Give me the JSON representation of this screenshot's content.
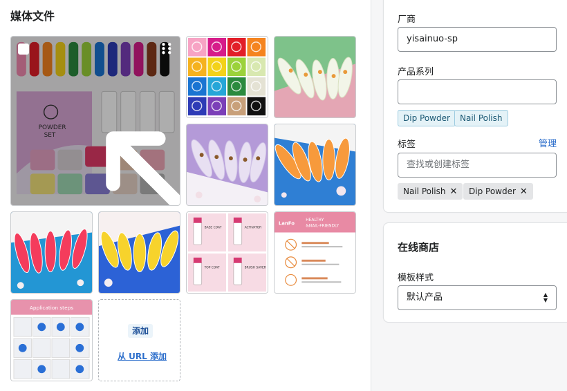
{
  "media": {
    "title": "媒体文件",
    "add_label": "添加",
    "add_url_label": "从 URL 添加",
    "tiles": [
      {
        "name": "powder-set-cover"
      },
      {
        "name": "color-swatch-grid"
      },
      {
        "name": "green-flower-nails"
      },
      {
        "name": "purple-flower-nails"
      },
      {
        "name": "orange-blue-nails"
      },
      {
        "name": "red-nails"
      },
      {
        "name": "yellow-nails"
      },
      {
        "name": "coat-bottles-grid"
      },
      {
        "name": "healthy-nail-friendly"
      },
      {
        "name": "application-steps"
      }
    ],
    "healthy_text": "HEALTHY\n&NAIL-FRIENDLY",
    "healthy_brand": "LanFo",
    "steps_title": "Application steps",
    "coat_labels": [
      "BASE COAT",
      "ACTIVATOR",
      "TOP COAT",
      "BRUSH SAVER"
    ]
  },
  "organization": {
    "vendor_label": "厂商",
    "vendor_value": "yisainuo-sp",
    "type_label": "产品系列",
    "type_value": "",
    "collections": [
      "Dip Powder",
      "Nail Polish"
    ],
    "tags_label": "标签",
    "manage_label": "管理",
    "tags_placeholder": "查找或创建标签",
    "tags": [
      "Nail Polish",
      "Dip Powder"
    ]
  },
  "online_store": {
    "title": "在线商店",
    "template_label": "模板样式",
    "template_value": "默认产品"
  },
  "colors": {
    "accent": "#2c6ecb",
    "chip_blue_bg": "#e4f2f7",
    "chip_gray_bg": "#e4e5e7"
  }
}
